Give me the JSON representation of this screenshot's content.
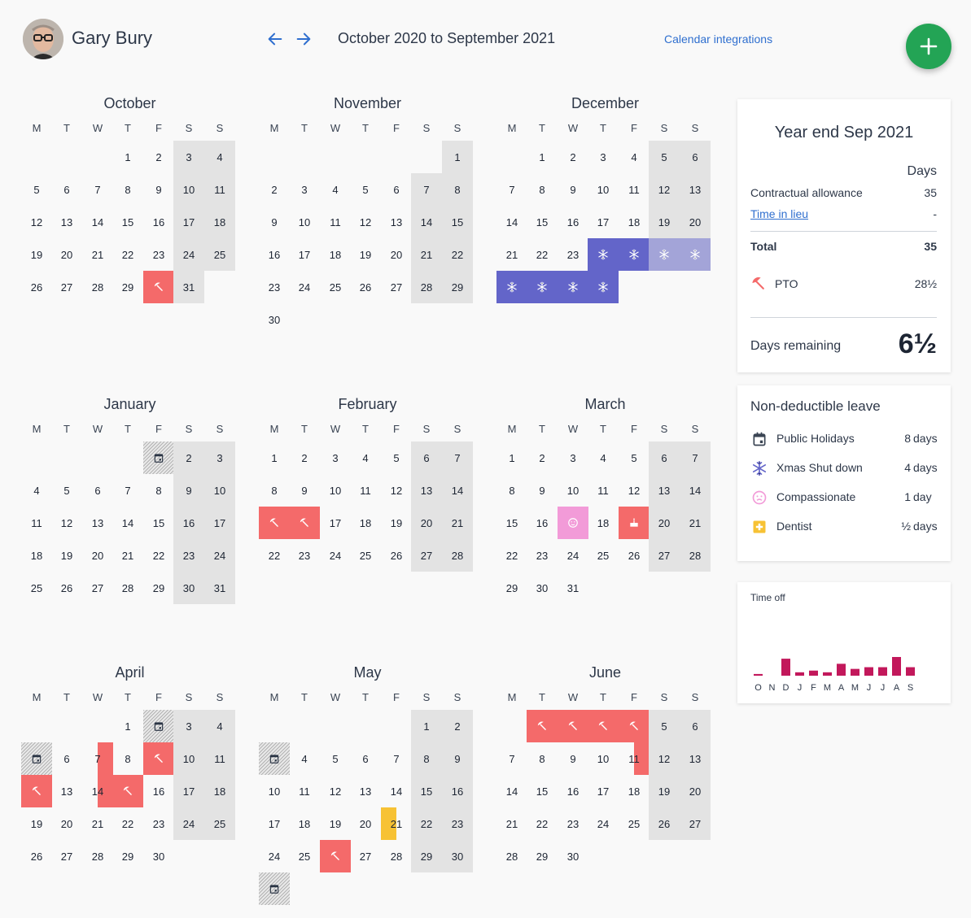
{
  "header": {
    "user_name": "Gary Bury",
    "date_range": "October 2020 to September 2021",
    "integrations_label": "Calendar integrations"
  },
  "colors": {
    "pto": "#f46a6a",
    "xmas_shutdown": "#6365c9",
    "compassionate": "#f29bd8",
    "dentist": "#f7c234",
    "weekend": "#e3e3e3",
    "accent": "#23a455",
    "link": "#2f6fcf",
    "chart_bar": "#c2185b"
  },
  "weekdays": [
    "M",
    "T",
    "W",
    "T",
    "F",
    "S",
    "S"
  ],
  "months": [
    {
      "name": "October",
      "offset": 3,
      "days": 31,
      "marks": {
        "30": "pto"
      }
    },
    {
      "name": "November",
      "offset": 6,
      "days": 30,
      "marks": {}
    },
    {
      "name": "December",
      "offset": 1,
      "days": 31,
      "marks": {
        "24": "xmas",
        "25": "xmas",
        "26": "xmas",
        "27": "xmas",
        "28": "xmas",
        "29": "xmas",
        "30": "xmas",
        "31": "xmas"
      }
    },
    {
      "name": "January",
      "offset": 4,
      "days": 31,
      "marks": {
        "1": "holiday"
      }
    },
    {
      "name": "February",
      "offset": 0,
      "days": 28,
      "marks": {
        "15": "pto",
        "16": "pto"
      }
    },
    {
      "name": "March",
      "offset": 0,
      "days": 31,
      "marks": {
        "17": "comp",
        "19": "dentist"
      }
    },
    {
      "name": "April",
      "offset": 3,
      "days": 30,
      "marks": {
        "2": "holiday",
        "5": "holiday",
        "7": "half",
        "9": "pto",
        "12": "pto",
        "14": "half",
        "15": "pto"
      }
    },
    {
      "name": "May",
      "offset": 5,
      "days": 31,
      "marks": {
        "3": "holiday",
        "21": "dentist_half",
        "26": "pto",
        "31": "holiday"
      }
    },
    {
      "name": "June",
      "offset": 1,
      "days": 30,
      "marks": {
        "1": "pto",
        "2": "pto",
        "3": "pto",
        "4": "pto",
        "11": "half"
      }
    }
  ],
  "summary": {
    "title": "Year end Sep 2021",
    "days_header": "Days",
    "contractual_label": "Contractual allowance",
    "contractual_value": "35",
    "lieu_label": "Time in lieu",
    "lieu_value": "-",
    "total_label": "Total",
    "total_value": "35",
    "pto_label": "PTO",
    "pto_value": "28½",
    "remaining_label": "Days remaining",
    "remaining_value": "6½"
  },
  "non_deductible": {
    "title": "Non-deductible leave",
    "items": [
      {
        "icon": "calendar-icon",
        "label": "Public Holidays",
        "count": "8",
        "unit": "days"
      },
      {
        "icon": "snowflake-icon",
        "label": "Xmas Shut down",
        "count": "4",
        "unit": "days"
      },
      {
        "icon": "sad-face-icon",
        "label": "Compassionate",
        "count": "1",
        "unit": "day"
      },
      {
        "icon": "medical-cross-icon",
        "label": "Dentist",
        "count": "½",
        "unit": "days"
      }
    ]
  },
  "time_off": {
    "title": "Time off",
    "labels": [
      "O",
      "N",
      "D",
      "J",
      "F",
      "M",
      "A",
      "M",
      "J",
      "J",
      "A",
      "S"
    ]
  },
  "chart_data": {
    "type": "bar",
    "title": "Time off",
    "categories": [
      "O",
      "N",
      "D",
      "J",
      "F",
      "M",
      "A",
      "M",
      "J",
      "J",
      "A",
      "S"
    ],
    "values": [
      0.5,
      0,
      5,
      1,
      1.5,
      1,
      3.5,
      2,
      2.5,
      2.5,
      5.5,
      2.5
    ]
  }
}
